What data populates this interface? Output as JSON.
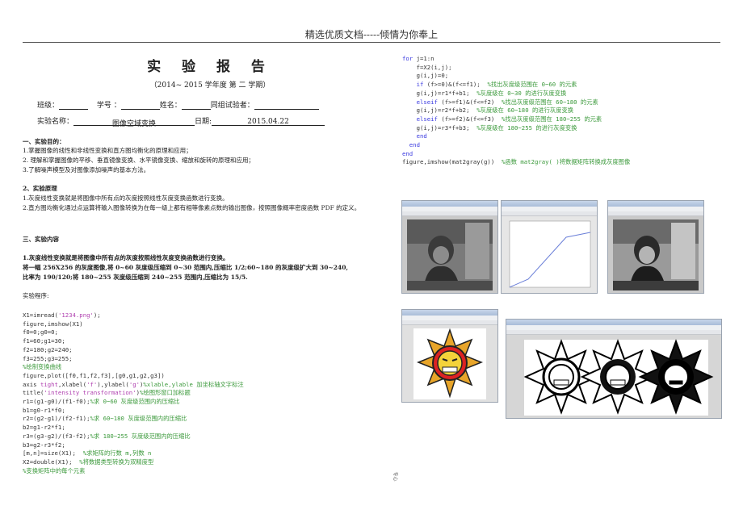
{
  "header": "精选优质文档-----倾情为你奉上",
  "title": "实 验 报 告",
  "semester": "（2014~ 2015 学年度    第 二 学期）",
  "info_line1": {
    "class_label": "班级：",
    "id_label": "学号 ：",
    "name_label": "姓名：",
    "partner_label": "同组试验者："
  },
  "info_line2": {
    "exp_label": "实验名称：",
    "exp_value": "图像空域变换",
    "date_label": "日期:",
    "date_value": "2015.04.22"
  },
  "sections": {
    "s1_title": "一、实验目的：",
    "s1_items": [
      "1.掌握图像的线性和非线性变换和直方图均衡化的原理和应用；",
      "2. 理解和掌握图像的平移、垂直镜像变换、水平镜像变换、缩放和旋转的原理和应用；",
      "3.了解噪声模型及对图像添加噪声的基本方法。"
    ],
    "s2_title": "2、实验原理",
    "s2_items": [
      "1.灰度线性变换就是将图像中所有点的灰度按照线性灰度变换函数进行变换。",
      "2.直方图均衡化通过点运算将输入图像转换为在每一级上都有相等像素点数的输出图像，按照图像概率密度函数 PDF 的定义。"
    ],
    "s3_title": "三、实验内容",
    "s3_bold": [
      "1.灰度线性变换就是将图像中所有点的灰度按照线性灰度变换函数进行变换。",
      "将一幅 256X256 的灰度图像,将 0~60 灰度级压缩到 0~30 范围内,压缩比 1/2;60~180 的灰度级扩大到 30~240,",
      "比率为 190/120;将 180~255 灰度级压缩到 240~255 范围内,压缩比为 15/5."
    ],
    "program_label": "实验程序:"
  },
  "code_left": [
    {
      "t": "X1=imread(",
      "s": "'1234.png'",
      "e": ");"
    },
    {
      "t": "figure,imshow(X1)"
    },
    {
      "t": "f0=0;g0=0;"
    },
    {
      "t": "f1=60;g1=30;"
    },
    {
      "t": "f2=180;g2=240;"
    },
    {
      "t": "f3=255;g3=255;"
    },
    {
      "c": "%绘制变换曲线"
    },
    {
      "t": "figure,plot([f0,f1,f2,f3],[g0,g1,g2,g3])"
    },
    {
      "t": "axis ",
      "s": "tight",
      "e": ",xlabel(",
      "s2": "'f'",
      "e2": "),ylabel(",
      "s3": "'g'",
      "e3": ")",
      "c": "%xlable,ylable 加坐标轴文字标注"
    },
    {
      "t": "title(",
      "s": "'intensity transformation'",
      "e": ")",
      "c": "%绘图形窗口加标题"
    },
    {
      "t": "r1=(g1-g0)/(f1-f0);",
      "c": "%求 0~60 灰度级范围内的压缩比"
    },
    {
      "t": "b1=g0-r1*f0;"
    },
    {
      "t": "r2=(g2-g1)/(f2-f1);",
      "c": "%求 60~180 灰度级范围内的压缩比"
    },
    {
      "t": "b2=g1-r2*f1;"
    },
    {
      "t": "r3=(g3-g2)/(f3-f2);",
      "c": "%求 180~255 灰度级范围内的压缩比"
    },
    {
      "t": "b3=g2-r3*f2;"
    },
    {
      "t": "[m,n]=size(X1);  ",
      "c": "%求矩阵的行数 m,列数 n"
    },
    {
      "t": "X2=double(X1);  ",
      "c": "%将数据类型转换为双精度型"
    },
    {
      "c": "%变换矩阵中的每个元素"
    }
  ],
  "code_right": [
    {
      "k": "for",
      "t": " j=1:n"
    },
    {
      "t": "    f=X2(i,j);"
    },
    {
      "t": "    g(i,j)=0;"
    },
    {
      "k": "    if",
      "t": " (f>=0)&(f<=f1);  ",
      "c": "%找出灰度级范围在 0~60 的元素"
    },
    {
      "t": "    g(i,j)=r1*f+b1;  ",
      "c": "%灰度级在 0~30 的进行灰度变换"
    },
    {
      "k": "    elseif",
      "t": " (f>=f1)&(f<=f2)  ",
      "c": "%找出灰度级范围在 60~180 的元素"
    },
    {
      "t": "    g(i,j)=r2*f+b2;  ",
      "c": "%灰度级在 60~180 的进行灰度变换"
    },
    {
      "k": "    elseif",
      "t": " (f>=f2)&(f<=f3)  ",
      "c": "%找出灰度级范围在 180~255 的元素"
    },
    {
      "t": "    g(i,j)=r3*f+b3;  ",
      "c": "%灰度级在 180~255 的进行灰度变换"
    },
    {
      "k": "    end"
    },
    {
      "k": "  end"
    },
    {
      "k": "end"
    },
    {
      "t": "figure,imshow(mat2gray(g))  ",
      "c": "%函数 mat2gray( )将数据矩阵转换成灰度图像"
    }
  ],
  "page_number": "专心",
  "colors": {
    "keyword": "#3a3ae0",
    "string": "#b040b0",
    "comment": "#3c9a3c",
    "plot_line": "#6a7fd8"
  }
}
